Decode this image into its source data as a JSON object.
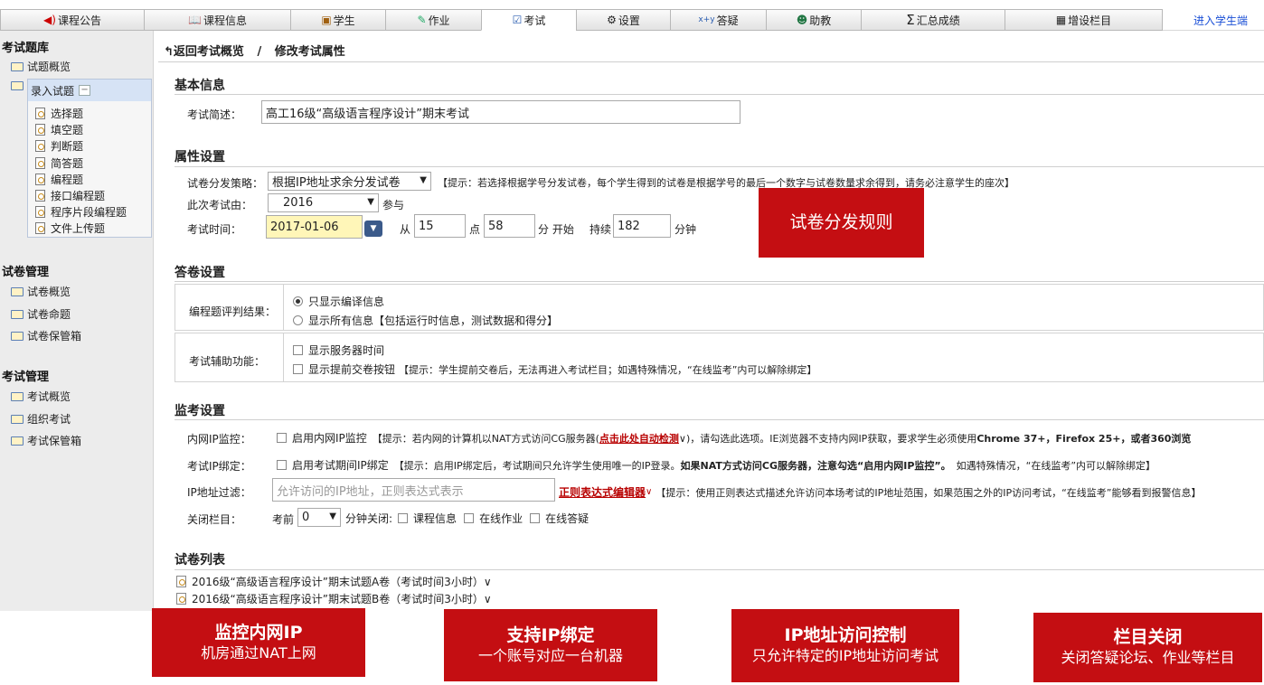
{
  "nav": {
    "tabs": [
      {
        "label": "课程公告",
        "icon": "speaker-icon"
      },
      {
        "label": "课程信息",
        "icon": "book-icon"
      },
      {
        "label": "学生",
        "icon": "student-icon"
      },
      {
        "label": "作业",
        "icon": "homework-icon"
      },
      {
        "label": "考试",
        "icon": "exam-icon"
      },
      {
        "label": "设置",
        "icon": "gear-icon"
      },
      {
        "label": "答疑",
        "icon": "question-icon"
      },
      {
        "label": "助教",
        "icon": "assistant-icon"
      },
      {
        "label": "汇总成绩",
        "icon": "sum-icon"
      },
      {
        "label": "增设栏目",
        "icon": "grid-icon"
      }
    ],
    "student_link": "进入学生端",
    "accent": "#1a4fd6"
  },
  "sidebar": {
    "sec1_title": "考试题库",
    "sec1_items": [
      "试题概览",
      "录入试题"
    ],
    "sub_items": [
      "选择题",
      "填空题",
      "判断题",
      "简答题",
      "编程题",
      "接口编程题",
      "程序片段编程题",
      "文件上传题"
    ],
    "sec2_title": "试卷管理",
    "sec2_items": [
      "试卷概览",
      "试卷命题",
      "试卷保管箱"
    ],
    "sec3_title": "考试管理",
    "sec3_items": [
      "考试概览",
      "组织考试",
      "考试保管箱"
    ]
  },
  "main": {
    "back_label": "返回考试概览",
    "sep": "/",
    "crumb": "修改考试属性",
    "basic": {
      "title": "基本信息",
      "desc_label": "考试简述：",
      "desc_value": "高工16级“高级语言程序设计”期末考试"
    },
    "attr": {
      "title": "属性设置",
      "strategy_label": "试卷分发策略：",
      "strategy_value": "根据IP地址求余分发试卷",
      "strategy_hint": "【提示：若选择根据学号分发试卷，每个学生得到的试卷是根据学号的最后一个数字与试卷数量求余得到，请务必注意学生的座次】",
      "from_label": "此次考试由：",
      "from_value": "2016",
      "from_suffix": "参与",
      "time_label": "考试时间：",
      "date_value": "2017-01-06",
      "from_word": "从",
      "hour": "15",
      "point_word": "点",
      "minute": "58",
      "start_word": "分 开始",
      "dur_word": "持续",
      "duration": "182",
      "min_word": "分钟"
    },
    "answer": {
      "title": "答卷设置",
      "judge_label": "编程题评判结果：",
      "opt1": "只显示编译信息",
      "opt2": "显示所有信息【包括运行时信息，测试数据和得分】",
      "assist_label": "考试辅助功能：",
      "cb1": "显示服务器时间",
      "cb2": "显示提前交卷按钮",
      "cb2_hint": "【提示：学生提前交卷后，无法再进入考试栏目；如遇特殊情况，“在线监考”内可以解除绑定】"
    },
    "monitor": {
      "title": "监考设置",
      "lan_label": "内网IP监控：",
      "lan_cb": "启用内网IP监控",
      "lan_hint_a": "【提示：若内网的计算机以NAT方式访问CG服务器(",
      "lan_link": "点击此处自动检测",
      "lan_hint_b": "∨)，请勾选此选项。IE浏览器不支持内网IP获取，要求学生必须使用",
      "lan_hint_bold": "Chrome 37+，Firefox 25+，或者360浏览",
      "bind_label": "考试IP绑定：",
      "bind_cb": "启用考试期间IP绑定",
      "bind_hint_a": "【提示：启用IP绑定后，考试期间只允许学生使用唯一的IP登录。",
      "bind_hint_bold": "如果NAT方式访问CG服务器，注意勾选“启用内网IP监控”。",
      "bind_hint_b": "如遇特殊情况，“在线监考”内可以解除绑定】",
      "filter_label": "IP地址过滤：",
      "filter_placeholder": "允许访问的IP地址，正则表达式表示",
      "filter_link": "正则表达式编辑器",
      "filter_hint": "【提示：使用正则表达式描述允许访问本场考试的IP地址范围，如果范围之外的IP访问考试，“在线监考”能够看到报警信息】",
      "close_label": "关闭栏目：",
      "close_pre": "考前",
      "close_value": "0",
      "close_suffix": "分钟关闭:",
      "close_items": [
        "课程信息",
        "在线作业",
        "在线答疑"
      ]
    },
    "papers": {
      "title": "试卷列表",
      "items": [
        "2016级“高级语言程序设计”期末试题A卷（考试时间3小时）∨",
        "2016级“高级语言程序设计”期末试题B卷（考试时间3小时）∨"
      ]
    }
  },
  "callouts": {
    "rule": "试卷分发规则",
    "c1_title": "监控内网IP",
    "c1_sub": "机房通过NAT上网",
    "c2_title": "支持IP绑定",
    "c2_sub": "一个账号对应一台机器",
    "c3_title": "IP地址访问控制",
    "c3_sub": "只允许特定的IP地址访问考试",
    "c4_title": "栏目关闭",
    "c4_sub": "关闭答疑论坛、作业等栏目",
    "color": "#c40e12"
  }
}
